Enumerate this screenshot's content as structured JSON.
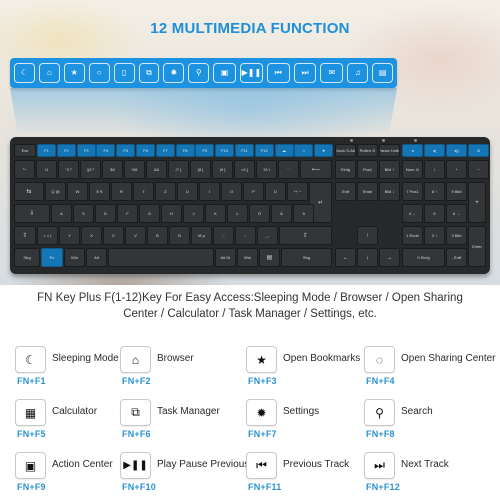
{
  "hero": {
    "title": "12 MULTIMEDIA FUNCTION"
  },
  "media_bar": {
    "icons": [
      {
        "name": "moon-icon",
        "glyph": "☾"
      },
      {
        "name": "home-icon",
        "glyph": "⌂"
      },
      {
        "name": "star-icon",
        "glyph": "★"
      },
      {
        "name": "refresh-icon",
        "glyph": "○"
      },
      {
        "name": "calculator-icon",
        "glyph": "▯"
      },
      {
        "name": "task-manager-icon",
        "glyph": "⧉"
      },
      {
        "name": "settings-icon",
        "glyph": "✹"
      },
      {
        "name": "search-icon",
        "glyph": "⚲"
      },
      {
        "name": "action-center-icon",
        "glyph": "▣"
      },
      {
        "name": "play-pause-icon",
        "glyph": "▶❚❚"
      },
      {
        "name": "previous-track-icon",
        "glyph": "⏮"
      },
      {
        "name": "next-track-icon",
        "glyph": "⏭"
      },
      {
        "name": "mail-icon",
        "glyph": "✉"
      },
      {
        "name": "music-icon",
        "glyph": "♫"
      },
      {
        "name": "computer-icon",
        "glyph": "▤"
      }
    ]
  },
  "keyboard": {
    "row_top": [
      "Esc",
      "F1",
      "F2",
      "F3",
      "F4",
      "F5",
      "F6",
      "F7",
      "F8",
      "F9",
      "F10",
      "F11",
      "F12",
      "☁",
      "⌂",
      "★",
      "Druck S-Abf",
      "Rollen ⊙",
      "Pause Untbr",
      "◂",
      "◂)",
      "◂))",
      "⊘"
    ],
    "row_num": [
      "°^",
      "!1",
      "\"2 ²",
      "§3 ³",
      "$4",
      "%5",
      "&6",
      "/7 {",
      "(8 [",
      ")9 ]",
      "=0 }",
      "?ß \\",
      "`´",
      "⟵",
      "Einfg",
      "Pos1",
      "Bild ↑",
      "Num ⊙",
      "/",
      "*",
      "−"
    ],
    "row_q": [
      "⇆",
      "Q @",
      "W",
      "E €",
      "R",
      "T",
      "Z",
      "U",
      "I",
      "O",
      "P",
      "Ü",
      "*+ ~",
      "↵",
      "Entf",
      "Ende",
      "Bild ↓",
      "7 Pos1",
      "8 ↑",
      "9 Bild",
      "+"
    ],
    "row_a": [
      "⇩",
      "A",
      "S",
      "D",
      "F",
      "G",
      "H",
      "J",
      "K",
      "L",
      "Ö",
      "Ä",
      "'#",
      "4 ←",
      "5",
      "6 →"
    ],
    "row_y": [
      "⇧",
      "> < |",
      "Y",
      "X",
      "C",
      "V",
      "B",
      "N",
      "M µ",
      ";,",
      ":.",
      "_-",
      "⇧",
      "↑",
      "1 Ende",
      "2 ↓",
      "3 Bild",
      "Enter"
    ],
    "row_bottom": [
      "Strg",
      "Fn",
      "Win",
      "Alt",
      "",
      "Alt Gr",
      "Win",
      "▤",
      "Strg",
      "←",
      "↓",
      "→",
      "0 Einfg",
      ", Entf"
    ]
  },
  "description": {
    "line1": "FN Key Plus F(1-12)Key For Easy Access:Sleeping Mode / Browser / Open Sharing",
    "line2": "Center / Calculator / Task Manager / Settings, etc."
  },
  "functions": [
    {
      "label": "Sleeping Mode",
      "combo": "FN+F1",
      "icon": "moon-icon",
      "glyph": "☾"
    },
    {
      "label": "Browser",
      "combo": "FN+F2",
      "icon": "home-icon",
      "glyph": "⌂"
    },
    {
      "label": "Open Bookmarks",
      "combo": "FN+F3",
      "icon": "star-icon",
      "glyph": "★"
    },
    {
      "label": "Open Sharing Center",
      "combo": "FN+F4",
      "icon": "refresh-icon",
      "glyph": "◌"
    },
    {
      "label": "Calculator",
      "combo": "FN+F5",
      "icon": "calculator-icon",
      "glyph": "▦"
    },
    {
      "label": "Task Manager",
      "combo": "FN+F6",
      "icon": "task-manager-icon",
      "glyph": "⧉"
    },
    {
      "label": "Settings",
      "combo": "FN+F7",
      "icon": "gear-icon",
      "glyph": "✹"
    },
    {
      "label": "Search",
      "combo": "FN+F8",
      "icon": "search-icon",
      "glyph": "⚲"
    },
    {
      "label": "Action Center",
      "combo": "FN+F9",
      "icon": "action-center-icon",
      "glyph": "▣"
    },
    {
      "label": "Play Pause Previous",
      "combo": "FN+F10",
      "icon": "play-pause-icon",
      "glyph": "▶❚❚"
    },
    {
      "label": "Previous Track",
      "combo": "FN+F11",
      "icon": "previous-track-icon",
      "glyph": "⏮"
    },
    {
      "label": "Next Track",
      "combo": "FN+F12",
      "icon": "next-track-icon",
      "glyph": "⏭"
    }
  ],
  "colors": {
    "accent_blue": "#1c92e0",
    "fn_key_blue": "#1576b5",
    "combo_text": "#2a93cf",
    "keyboard_body": "#26282a"
  }
}
